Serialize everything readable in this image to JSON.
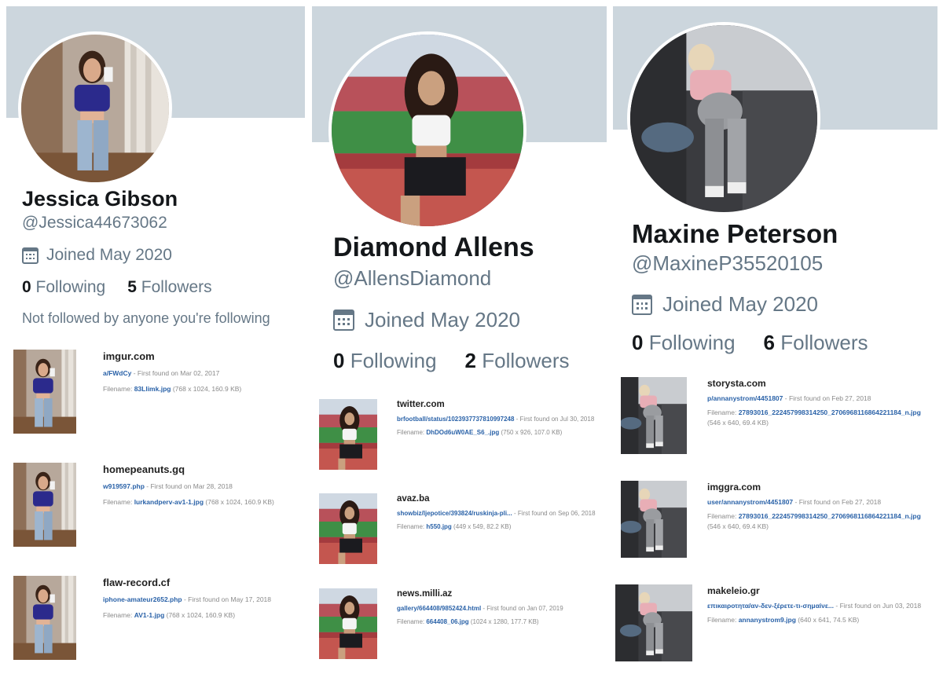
{
  "profiles": [
    {
      "name": "Jessica Gibson",
      "handle": "@Jessica44673062",
      "joined": "Joined May 2020",
      "following_count": "0",
      "following_label": "Following",
      "followers_count": "5",
      "followers_label": "Followers",
      "note": "Not followed by anyone you're following",
      "results": [
        {
          "domain": "imgur.com",
          "path": "a/FWdCy",
          "found": " - First found on Mar 02, 2017",
          "filename_label": "Filename: ",
          "filename": "83Llimk.jpg",
          "meta": " (768 x 1024, 160.9 KB)"
        },
        {
          "domain": "homepeanuts.gq",
          "path": "w919597.php",
          "found": " - First found on Mar 28, 2018",
          "filename_label": "Filename: ",
          "filename": "lurkandperv-av1-1.jpg",
          "meta": " (768 x 1024, 160.9 KB)"
        },
        {
          "domain": "flaw-record.cf",
          "path": "iphone-amateur2652.php",
          "found": " - First found on May 17, 2018",
          "filename_label": "Filename: ",
          "filename": "AV1-1.jpg",
          "meta": " (768 x 1024, 160.9 KB)"
        }
      ]
    },
    {
      "name": "Diamond Allens",
      "handle": "@AllensDiamond",
      "joined": "Joined May 2020",
      "following_count": "0",
      "following_label": "Following",
      "followers_count": "2",
      "followers_label": "Followers",
      "results": [
        {
          "domain": "twitter.com",
          "path": "brfootball/status/1023937737810997248",
          "found": " - First found on Jul 30, 2018",
          "filename_label": "Filename: ",
          "filename": "DhDOd6uW0AE_S6_.jpg",
          "meta": " (750 x 926, 107.0 KB)"
        },
        {
          "domain": "avaz.ba",
          "path": "showbiz/ljepotice/393824/ruskinja-pli...",
          "found": " - First found on Sep 06, 2018",
          "filename_label": "Filename: ",
          "filename": "h550.jpg",
          "meta": " (449 x 549, 82.2 KB)"
        },
        {
          "domain": "news.milli.az",
          "path": "gallery/664408/9852424.html",
          "found": " - First found on Jan 07, 2019",
          "filename_label": "Filename: ",
          "filename": "664408_06.jpg",
          "meta": " (1024 x 1280, 177.7 KB)"
        }
      ]
    },
    {
      "name": "Maxine Peterson",
      "handle": "@MaxineP35520105",
      "joined": "Joined May 2020",
      "following_count": "0",
      "following_label": "Following",
      "followers_count": "6",
      "followers_label": "Followers",
      "results": [
        {
          "domain": "storysta.com",
          "path": "p/annanystrom/4451807",
          "found": " - First found on Feb 27, 2018",
          "filename_label": "Filename: ",
          "filename": "27893016_222457998314250_2706968116864221184_n.jpg",
          "meta": "(546 x 640, 69.4 KB)"
        },
        {
          "domain": "imggra.com",
          "path": "user/annanystrom/4451807",
          "found": " - First found on Feb 27, 2018",
          "filename_label": "Filename: ",
          "filename": "27893016_222457998314250_2706968116864221184_n.jpg",
          "meta": "(546 x 640, 69.4 KB)"
        },
        {
          "domain": "makeleio.gr",
          "path": "επικαιροτητα/αν-δεν-ξέρετε-τι-σημαίνε...",
          "found": " - First found on Jun 03, 2018",
          "filename_label": "Filename: ",
          "filename": "annanystrom9.jpg",
          "meta": " (640 x 641, 74.5 KB)"
        }
      ]
    }
  ],
  "colors": {
    "banner": "#ccd6dd",
    "muted": "#657786",
    "link": "#2a62a8",
    "text": "#14171a"
  }
}
